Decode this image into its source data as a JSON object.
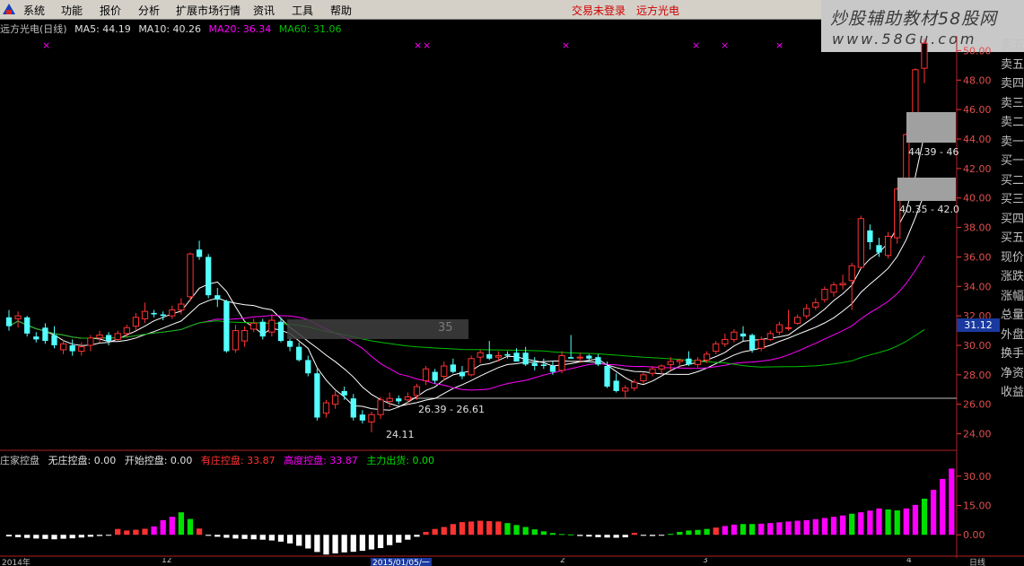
{
  "menu": {
    "items": [
      "系统",
      "功能",
      "报价",
      "分析",
      "扩展市场行情",
      "资讯",
      "工具",
      "帮助"
    ],
    "status_login": "交易未登录",
    "status_stock": "远方光电"
  },
  "watermark": {
    "line1": "炒股辅助教材58股网",
    "line2": "www.58Gu.com"
  },
  "infobar": {
    "title": "远方光电(日线)",
    "ma5": "MA5: 44.19",
    "ma10": "MA10: 40.26",
    "ma20": "MA20: 36.34",
    "ma60": "MA60: 31.06"
  },
  "price_axis": {
    "ticks": [
      "50.00",
      "48.00",
      "46.00",
      "44.00",
      "42.00",
      "40.00",
      "38.00",
      "36.00",
      "34.00",
      "32.00",
      "30.00",
      "28.00",
      "26.00",
      "24.00"
    ],
    "current": "31.12"
  },
  "annotations": {
    "range_high": "44.39 - 46",
    "range_mid": "40.35 - 42.0",
    "range_low": "26.39 - 26.61",
    "low_mark": "24.11",
    "overlay_num": "35"
  },
  "indicator_legend": {
    "name": "庄家控盘",
    "no_ctrl": "无庄控盘: 0.00",
    "start_ctrl": "开始控盘: 0.00",
    "has_ctrl": "有庄控盘: 33.87",
    "high_ctrl": "高度控盘: 33.87",
    "exit": "主力出货: 0.00"
  },
  "indicator_axis": {
    "ticks": [
      "30.00",
      "15.00",
      "0.00"
    ]
  },
  "right_panel": [
    "卖五",
    "卖五",
    "卖四",
    "卖三",
    "卖二",
    "卖一",
    "买一",
    "买二",
    "买三",
    "买四",
    "买五",
    "现价",
    "涨跌",
    "涨幅",
    "总量",
    "外盘",
    "换手",
    "净资",
    "收益"
  ],
  "bottom_axis": {
    "labels": [
      "2014年",
      "12",
      "2015/01/05/一",
      "2",
      "3",
      "4",
      "日线"
    ]
  },
  "colors": {
    "up": "#ff3232",
    "down": "#54ffff",
    "ma5": "#ffffff",
    "ma10": "#ffffff",
    "ma20": "#ff00ff",
    "ma60": "#00c000",
    "axis": "#ff3232"
  },
  "chart_data": {
    "type": "candlestick",
    "title": "远方光电(日线)",
    "ylim": [
      23,
      51
    ],
    "candles": [
      {
        "o": 31.9,
        "h": 32.4,
        "l": 31.0,
        "c": 31.3
      },
      {
        "o": 31.8,
        "h": 32.3,
        "l": 31.2,
        "c": 32.0
      },
      {
        "o": 31.9,
        "h": 32.0,
        "l": 30.6,
        "c": 30.8
      },
      {
        "o": 30.6,
        "h": 30.9,
        "l": 30.2,
        "c": 30.4
      },
      {
        "o": 31.2,
        "h": 31.5,
        "l": 30.1,
        "c": 30.3
      },
      {
        "o": 30.7,
        "h": 31.3,
        "l": 29.8,
        "c": 30.0
      },
      {
        "o": 29.7,
        "h": 30.4,
        "l": 29.4,
        "c": 30.1
      },
      {
        "o": 30.0,
        "h": 30.4,
        "l": 29.3,
        "c": 29.6
      },
      {
        "o": 29.6,
        "h": 30.2,
        "l": 29.3,
        "c": 29.9
      },
      {
        "o": 30.0,
        "h": 30.7,
        "l": 29.6,
        "c": 30.5
      },
      {
        "o": 30.5,
        "h": 31.0,
        "l": 30.2,
        "c": 30.7
      },
      {
        "o": 30.7,
        "h": 30.9,
        "l": 30.0,
        "c": 30.3
      },
      {
        "o": 30.4,
        "h": 31.0,
        "l": 30.3,
        "c": 30.8
      },
      {
        "o": 30.8,
        "h": 31.4,
        "l": 30.6,
        "c": 31.2
      },
      {
        "o": 31.3,
        "h": 32.2,
        "l": 31.0,
        "c": 31.9
      },
      {
        "o": 31.8,
        "h": 32.9,
        "l": 31.5,
        "c": 32.3
      },
      {
        "o": 32.2,
        "h": 32.4,
        "l": 31.9,
        "c": 32.1
      },
      {
        "o": 32.1,
        "h": 32.3,
        "l": 31.7,
        "c": 32.0
      },
      {
        "o": 32.0,
        "h": 32.7,
        "l": 31.8,
        "c": 32.4
      },
      {
        "o": 32.4,
        "h": 33.2,
        "l": 32.1,
        "c": 32.8
      },
      {
        "o": 33.3,
        "h": 36.3,
        "l": 33.0,
        "c": 36.2
      },
      {
        "o": 36.5,
        "h": 37.1,
        "l": 35.8,
        "c": 36.0
      },
      {
        "o": 36.0,
        "h": 36.2,
        "l": 33.2,
        "c": 33.4
      },
      {
        "o": 33.4,
        "h": 33.9,
        "l": 32.6,
        "c": 33.1
      },
      {
        "o": 33.0,
        "h": 33.1,
        "l": 29.5,
        "c": 29.6
      },
      {
        "o": 29.7,
        "h": 31.4,
        "l": 29.5,
        "c": 31.0
      },
      {
        "o": 30.3,
        "h": 31.3,
        "l": 29.9,
        "c": 31.0
      },
      {
        "o": 31.1,
        "h": 31.8,
        "l": 30.9,
        "c": 31.5
      },
      {
        "o": 31.6,
        "h": 31.8,
        "l": 30.4,
        "c": 30.6
      },
      {
        "o": 30.9,
        "h": 32.1,
        "l": 30.6,
        "c": 31.7
      },
      {
        "o": 31.6,
        "h": 31.9,
        "l": 30.2,
        "c": 30.3
      },
      {
        "o": 30.3,
        "h": 30.6,
        "l": 29.6,
        "c": 29.9
      },
      {
        "o": 29.9,
        "h": 30.2,
        "l": 28.9,
        "c": 29.0
      },
      {
        "o": 29.0,
        "h": 29.3,
        "l": 27.9,
        "c": 28.1
      },
      {
        "o": 28.1,
        "h": 28.4,
        "l": 24.9,
        "c": 25.1
      },
      {
        "o": 25.4,
        "h": 26.3,
        "l": 25.1,
        "c": 26.1
      },
      {
        "o": 26.0,
        "h": 26.9,
        "l": 25.7,
        "c": 26.6
      },
      {
        "o": 26.9,
        "h": 27.2,
        "l": 26.3,
        "c": 26.6
      },
      {
        "o": 26.4,
        "h": 26.7,
        "l": 24.9,
        "c": 25.1
      },
      {
        "o": 25.3,
        "h": 25.6,
        "l": 24.7,
        "c": 24.9
      },
      {
        "o": 24.8,
        "h": 25.5,
        "l": 24.1,
        "c": 25.3
      },
      {
        "o": 25.3,
        "h": 26.5,
        "l": 25.0,
        "c": 26.3
      },
      {
        "o": 26.2,
        "h": 26.8,
        "l": 25.8,
        "c": 26.4
      },
      {
        "o": 26.4,
        "h": 26.6,
        "l": 26.0,
        "c": 26.2
      },
      {
        "o": 26.3,
        "h": 26.8,
        "l": 26.0,
        "c": 26.5
      },
      {
        "o": 26.6,
        "h": 27.4,
        "l": 26.3,
        "c": 27.2
      },
      {
        "o": 27.6,
        "h": 28.6,
        "l": 27.3,
        "c": 28.4
      },
      {
        "o": 28.2,
        "h": 28.4,
        "l": 27.4,
        "c": 27.6
      },
      {
        "o": 27.9,
        "h": 28.9,
        "l": 27.6,
        "c": 28.6
      },
      {
        "o": 28.7,
        "h": 29.1,
        "l": 28.1,
        "c": 28.2
      },
      {
        "o": 28.2,
        "h": 28.6,
        "l": 27.7,
        "c": 27.9
      },
      {
        "o": 28.0,
        "h": 29.3,
        "l": 27.9,
        "c": 29.1
      },
      {
        "o": 29.2,
        "h": 29.7,
        "l": 28.8,
        "c": 29.5
      },
      {
        "o": 29.4,
        "h": 30.3,
        "l": 29.0,
        "c": 29.1
      },
      {
        "o": 29.2,
        "h": 29.6,
        "l": 28.9,
        "c": 29.3
      },
      {
        "o": 29.4,
        "h": 29.6,
        "l": 29.1,
        "c": 29.3
      },
      {
        "o": 29.5,
        "h": 29.8,
        "l": 28.9,
        "c": 28.9
      },
      {
        "o": 29.5,
        "h": 29.9,
        "l": 28.6,
        "c": 28.7
      },
      {
        "o": 28.8,
        "h": 29.2,
        "l": 28.3,
        "c": 28.6
      },
      {
        "o": 28.7,
        "h": 29.1,
        "l": 28.4,
        "c": 28.6
      },
      {
        "o": 28.6,
        "h": 28.9,
        "l": 28.0,
        "c": 28.2
      },
      {
        "o": 28.3,
        "h": 29.6,
        "l": 28.1,
        "c": 29.3
      },
      {
        "o": 29.2,
        "h": 30.7,
        "l": 29.1,
        "c": 29.1
      },
      {
        "o": 29.2,
        "h": 29.5,
        "l": 28.8,
        "c": 29.2
      },
      {
        "o": 29.3,
        "h": 29.4,
        "l": 28.9,
        "c": 29.1
      },
      {
        "o": 29.2,
        "h": 29.4,
        "l": 28.6,
        "c": 28.7
      },
      {
        "o": 28.6,
        "h": 28.9,
        "l": 27.1,
        "c": 27.2
      },
      {
        "o": 27.6,
        "h": 28.1,
        "l": 26.8,
        "c": 26.9
      },
      {
        "o": 26.9,
        "h": 27.3,
        "l": 26.4,
        "c": 27.1
      },
      {
        "o": 27.1,
        "h": 27.7,
        "l": 26.9,
        "c": 27.5
      },
      {
        "o": 27.6,
        "h": 28.2,
        "l": 27.4,
        "c": 28.0
      },
      {
        "o": 28.1,
        "h": 28.6,
        "l": 27.9,
        "c": 28.4
      },
      {
        "o": 28.4,
        "h": 28.7,
        "l": 28.0,
        "c": 28.6
      },
      {
        "o": 28.7,
        "h": 29.2,
        "l": 28.3,
        "c": 28.9
      },
      {
        "o": 28.9,
        "h": 29.1,
        "l": 28.5,
        "c": 29.0
      },
      {
        "o": 29.1,
        "h": 29.6,
        "l": 28.6,
        "c": 28.7
      },
      {
        "o": 28.7,
        "h": 29.2,
        "l": 28.5,
        "c": 29.0
      },
      {
        "o": 29.0,
        "h": 29.6,
        "l": 28.8,
        "c": 29.4
      },
      {
        "o": 29.6,
        "h": 30.3,
        "l": 29.4,
        "c": 30.1
      },
      {
        "o": 30.1,
        "h": 30.8,
        "l": 29.9,
        "c": 30.4
      },
      {
        "o": 30.4,
        "h": 31.1,
        "l": 30.2,
        "c": 30.9
      },
      {
        "o": 30.8,
        "h": 31.3,
        "l": 30.3,
        "c": 30.6
      },
      {
        "o": 30.7,
        "h": 30.8,
        "l": 29.5,
        "c": 29.7
      },
      {
        "o": 29.8,
        "h": 30.6,
        "l": 29.6,
        "c": 30.4
      },
      {
        "o": 30.4,
        "h": 31.0,
        "l": 30.3,
        "c": 30.8
      },
      {
        "o": 30.9,
        "h": 31.6,
        "l": 30.7,
        "c": 31.4
      },
      {
        "o": 31.2,
        "h": 32.4,
        "l": 31.0,
        "c": 31.2
      },
      {
        "o": 31.5,
        "h": 32.1,
        "l": 31.4,
        "c": 31.9
      },
      {
        "o": 32.0,
        "h": 32.8,
        "l": 31.8,
        "c": 32.5
      },
      {
        "o": 32.6,
        "h": 33.2,
        "l": 32.4,
        "c": 32.9
      },
      {
        "o": 33.1,
        "h": 34.0,
        "l": 32.9,
        "c": 33.8
      },
      {
        "o": 33.6,
        "h": 34.3,
        "l": 33.3,
        "c": 34.1
      },
      {
        "o": 34.1,
        "h": 34.8,
        "l": 33.8,
        "c": 34.2
      },
      {
        "o": 34.4,
        "h": 35.6,
        "l": 32.4,
        "c": 35.4
      },
      {
        "o": 35.3,
        "h": 38.8,
        "l": 35.2,
        "c": 38.6
      },
      {
        "o": 37.8,
        "h": 38.2,
        "l": 36.5,
        "c": 37.0
      },
      {
        "o": 36.8,
        "h": 37.3,
        "l": 36.0,
        "c": 36.3
      },
      {
        "o": 36.1,
        "h": 37.7,
        "l": 35.9,
        "c": 37.4
      },
      {
        "o": 37.3,
        "h": 40.7,
        "l": 36.9,
        "c": 40.6
      },
      {
        "o": 40.6,
        "h": 44.4,
        "l": 40.3,
        "c": 44.3
      },
      {
        "o": 44.4,
        "h": 48.8,
        "l": 44.2,
        "c": 48.7
      },
      {
        "o": 48.8,
        "h": 50.8,
        "l": 47.8,
        "c": 50.5
      }
    ],
    "x_markers_count": 7,
    "indicator": {
      "name": "庄家控盘",
      "ylim": [
        -10,
        35
      ],
      "values": [
        -0.8,
        -1.2,
        -1.6,
        -1.9,
        -2.1,
        -2.3,
        -2.0,
        -1.8,
        -1.4,
        -1.0,
        -0.6,
        -0.3,
        3.0,
        2.2,
        2.6,
        3.1,
        4.3,
        7.5,
        9.2,
        11.5,
        8.1,
        3.2,
        -0.5,
        -1.0,
        -1.5,
        -1.9,
        -2.1,
        -2.3,
        -2.5,
        -2.9,
        -3.5,
        -4.4,
        -5.6,
        -7.0,
        -8.8,
        -10.1,
        -9.5,
        -9.0,
        -8.7,
        -8.2,
        -7.5,
        -6.8,
        -5.3,
        -4.0,
        -2.5,
        -1.0,
        1.5,
        3.0,
        4.0,
        5.5,
        6.5,
        6.8,
        7.2,
        7.0,
        6.8,
        6.0,
        5.0,
        4.0,
        2.8,
        1.8,
        0.9,
        0.4,
        0.2,
        -0.6,
        -0.9,
        -1.2,
        -1.4,
        -1.5,
        -1.3,
        1.0,
        -0.5,
        -0.6,
        -0.4,
        0.5,
        1.5,
        2.2,
        2.5,
        3.0,
        3.7,
        4.5,
        5.2,
        5.5,
        5.5,
        5.7,
        6.0,
        6.4,
        6.8,
        7.2,
        7.5,
        8.0,
        8.6,
        9.2,
        9.9,
        10.8,
        11.5,
        12.4,
        13.5,
        13.0,
        12.5,
        13.5,
        15.3,
        18.5,
        23.0,
        28.6,
        33.9
      ],
      "colors": [
        "w",
        "w",
        "w",
        "w",
        "w",
        "w",
        "w",
        "w",
        "w",
        "w",
        "w",
        "w",
        "r",
        "r",
        "r",
        "r",
        "m",
        "m",
        "m",
        "g",
        "g",
        "r",
        "w",
        "w",
        "w",
        "w",
        "w",
        "w",
        "w",
        "w",
        "w",
        "w",
        "w",
        "w",
        "w",
        "w",
        "w",
        "w",
        "w",
        "w",
        "w",
        "w",
        "w",
        "w",
        "w",
        "w",
        "r",
        "r",
        "r",
        "r",
        "r",
        "r",
        "r",
        "r",
        "r",
        "g",
        "g",
        "g",
        "g",
        "g",
        "g",
        "g",
        "g",
        "w",
        "w",
        "w",
        "w",
        "w",
        "w",
        "r",
        "w",
        "w",
        "w",
        "g",
        "g",
        "g",
        "g",
        "g",
        "r",
        "m",
        "m",
        "g",
        "g",
        "m",
        "m",
        "m",
        "m",
        "m",
        "m",
        "m",
        "m",
        "m",
        "m",
        "g",
        "m",
        "m",
        "m",
        "g",
        "g",
        "m",
        "m",
        "g",
        "m",
        "m",
        "m"
      ]
    }
  }
}
